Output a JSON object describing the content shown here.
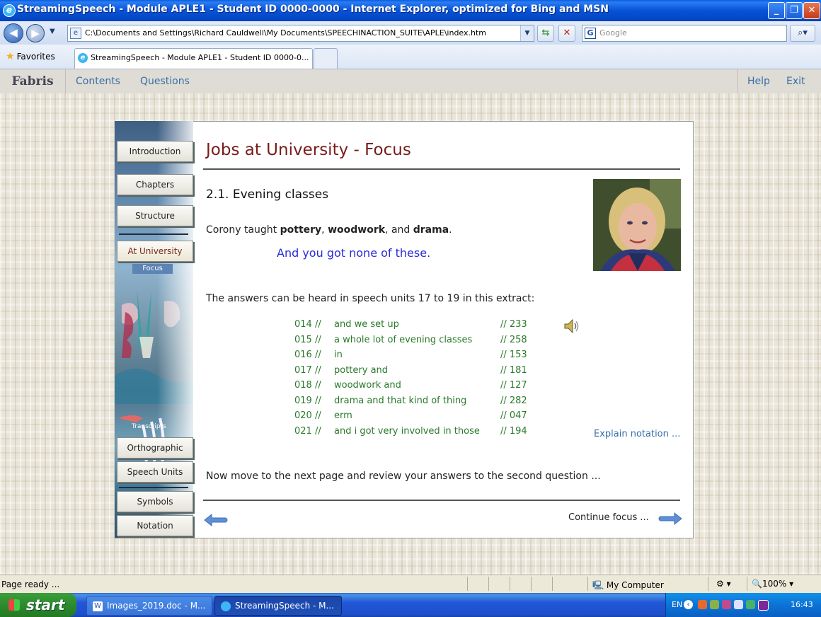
{
  "window": {
    "title": "StreamingSpeech - Module APLE1 - Student ID 0000-0000 - Internet Explorer, optimized for Bing and MSN",
    "icon": "ie-icon"
  },
  "browser": {
    "address": "C:\\Documents and Settings\\Richard Cauldwell\\My Documents\\SPEECHINACTION_SUITE\\APLE\\index.htm",
    "search_placeholder": "Google",
    "favorites_label": "Favorites",
    "tab_title": "StreamingSpeech - Module APLE1 - Student ID 0000-0..."
  },
  "appmenu": {
    "brand": "Fabris",
    "left_items": [
      "Contents",
      "Questions"
    ],
    "right_items": [
      "Help",
      "Exit"
    ]
  },
  "sidebar": {
    "buttons": [
      "Introduction",
      "Chapters",
      "Structure",
      "At University"
    ],
    "sub_item": "Focus",
    "transcripts_label": "Transcripts",
    "transcript_buttons": [
      "Orthographic",
      "Speech Units"
    ],
    "bottom_buttons": [
      "Symbols",
      "Notation"
    ]
  },
  "content": {
    "title": "Jobs at University - Focus",
    "section_title": "2.1. Evening classes",
    "sentence_prefix": "Corony taught ",
    "bold1": "pottery",
    "sep1": ", ",
    "bold2": "woodwork",
    "sep2": ", and ",
    "bold3": "drama",
    "end": ".",
    "blue_line": "And you got none of these.",
    "answers_line": "The answers can be heard in speech units 17 to 19 in this extract:",
    "transcript": [
      {
        "num": "014  //",
        "text": "and we set up",
        "ms": "// 233"
      },
      {
        "num": "015  //",
        "text": "a whole lot of evening classes",
        "ms": "// 258"
      },
      {
        "num": "016  //",
        "text": "in",
        "ms": "// 153"
      },
      {
        "num": "017  //",
        "text": "pottery and",
        "ms": "// 181"
      },
      {
        "num": "018  //",
        "text": "woodwork and",
        "ms": "// 127"
      },
      {
        "num": "019  //",
        "text": "drama and that kind of thing",
        "ms": "// 282"
      },
      {
        "num": "020  //",
        "text": "erm",
        "ms": "// 047"
      },
      {
        "num": "021  //",
        "text": "and i got very involved in those",
        "ms": "// 194"
      }
    ],
    "explain_link": "Explain notation ...",
    "next_line": "Now move to the next page and review your answers to the second question ...",
    "continue_label": "Continue focus ..."
  },
  "status": {
    "text": "Page ready ...",
    "zone": "My Computer",
    "zoom": "100%"
  },
  "taskbar": {
    "start": "start",
    "items": [
      "Images_2019.doc - M...",
      "StreamingSpeech - M..."
    ],
    "lang": "EN",
    "time": "16:43"
  },
  "colors": {
    "title_red": "#7a1a1a",
    "link_blue": "#3A6EA8",
    "transcript_green": "#2a7a2a",
    "emphasis_blue": "#2a2ad8"
  }
}
